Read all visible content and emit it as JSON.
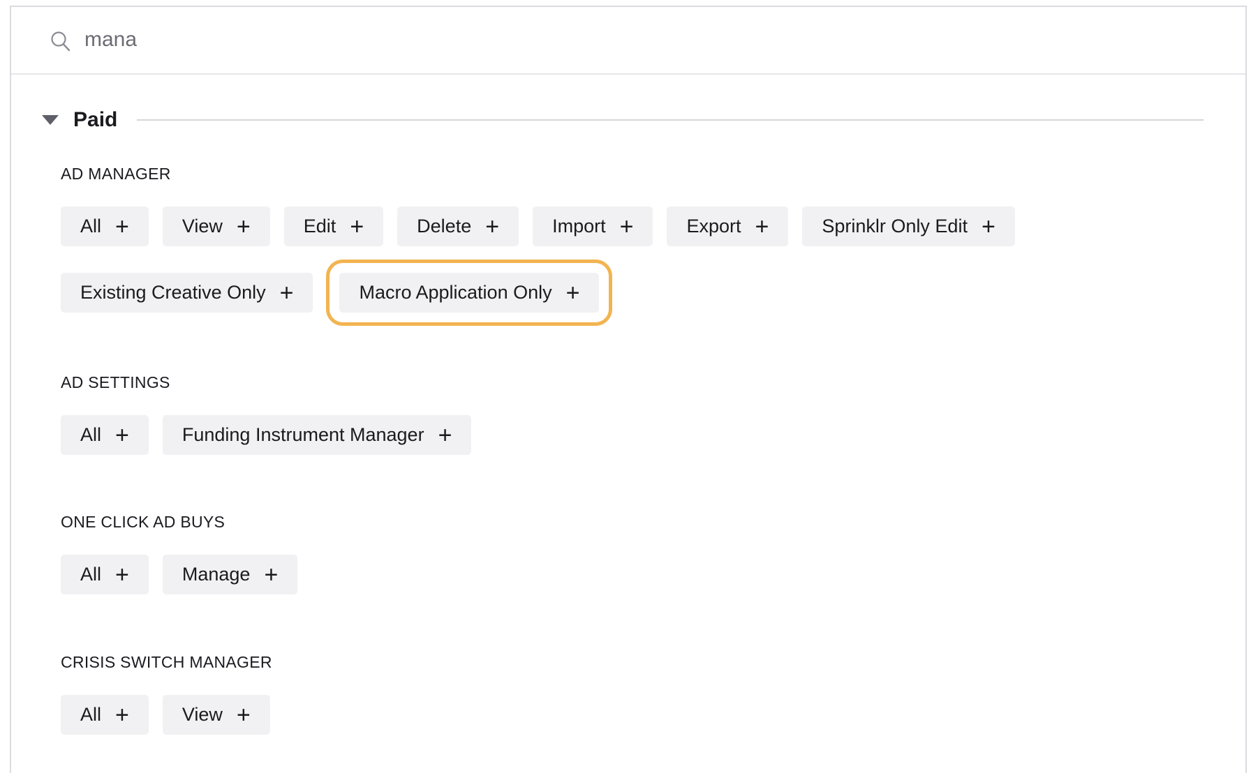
{
  "search": {
    "value": "mana",
    "icon": "search-icon"
  },
  "group": {
    "title": "Paid",
    "expanded": true
  },
  "highlight_color": "#f2b451",
  "sections": [
    {
      "label": "AD MANAGER",
      "chips": [
        "All",
        "View",
        "Edit",
        "Delete",
        "Import",
        "Export",
        "Sprinklr Only Edit",
        "Existing Creative Only",
        "Macro Application Only"
      ]
    },
    {
      "label": "AD SETTINGS",
      "chips": [
        "All",
        "Funding Instrument Manager"
      ]
    },
    {
      "label": "ONE CLICK AD BUYS",
      "chips": [
        "All",
        "Manage"
      ]
    },
    {
      "label": "CRISIS SWITCH MANAGER",
      "chips": [
        "All",
        "View"
      ]
    }
  ],
  "plus_symbol": "+"
}
